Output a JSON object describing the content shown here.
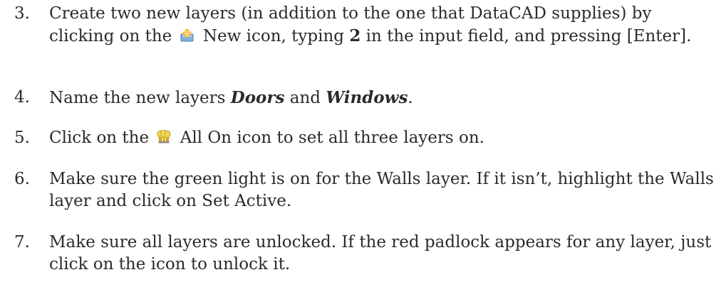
{
  "steps": [
    {
      "number": "3.",
      "parts": [
        "Create two new layers (in addition to the one that DataCAD supplies) by clicking on the",
        "New icon, typing",
        "2",
        "in the input field, and pressing [Enter]."
      ],
      "icon": "new-layer-icon"
    },
    {
      "number": "4.",
      "parts": [
        "Name the new layers",
        "Doors",
        "and",
        "Windows",
        "."
      ]
    },
    {
      "number": "5.",
      "parts": [
        "Click on the",
        "All On icon to set all three layers on."
      ],
      "icon": "all-on-bulbs-icon"
    },
    {
      "number": "6.",
      "text": "Make sure the green light is on for the Walls layer. If it isn’t, highlight the Walls layer and click on Set Active."
    },
    {
      "number": "7.",
      "text": "Make sure all layers are unlocked. If the red padlock appears for any layer, just click on the icon to unlock it."
    }
  ],
  "colors": {
    "text": "#2b2b2b",
    "new_icon_plus": "#f2a51e",
    "new_icon_sheet": "#7fb0de",
    "bulb": "#f2d64b"
  }
}
